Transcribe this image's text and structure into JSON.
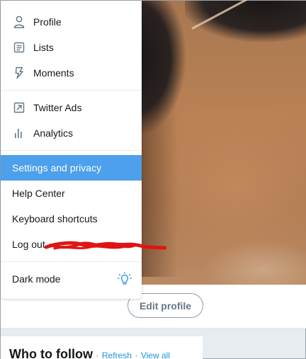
{
  "menu": {
    "items": [
      {
        "label": "Profile",
        "icon": "person-icon"
      },
      {
        "label": "Lists",
        "icon": "list-icon"
      },
      {
        "label": "Moments",
        "icon": "lightning-icon"
      },
      {
        "label": "Twitter Ads",
        "icon": "arrow-out-icon"
      },
      {
        "label": "Analytics",
        "icon": "bar-chart-icon"
      },
      {
        "label": "Settings and privacy"
      },
      {
        "label": "Help Center"
      },
      {
        "label": "Keyboard shortcuts"
      },
      {
        "label": "Log out"
      },
      {
        "label": "Dark mode",
        "icon": "lightbulb-icon"
      }
    ],
    "highlight_color": "#4ca0ec"
  },
  "profile": {
    "edit_label": "Edit profile"
  },
  "who_to_follow": {
    "title": "Who to follow",
    "separator": "·",
    "refresh_label": "Refresh",
    "view_all_label": "View all"
  },
  "colors": {
    "accent": "#1b95e0",
    "redaction": "#e01414"
  }
}
